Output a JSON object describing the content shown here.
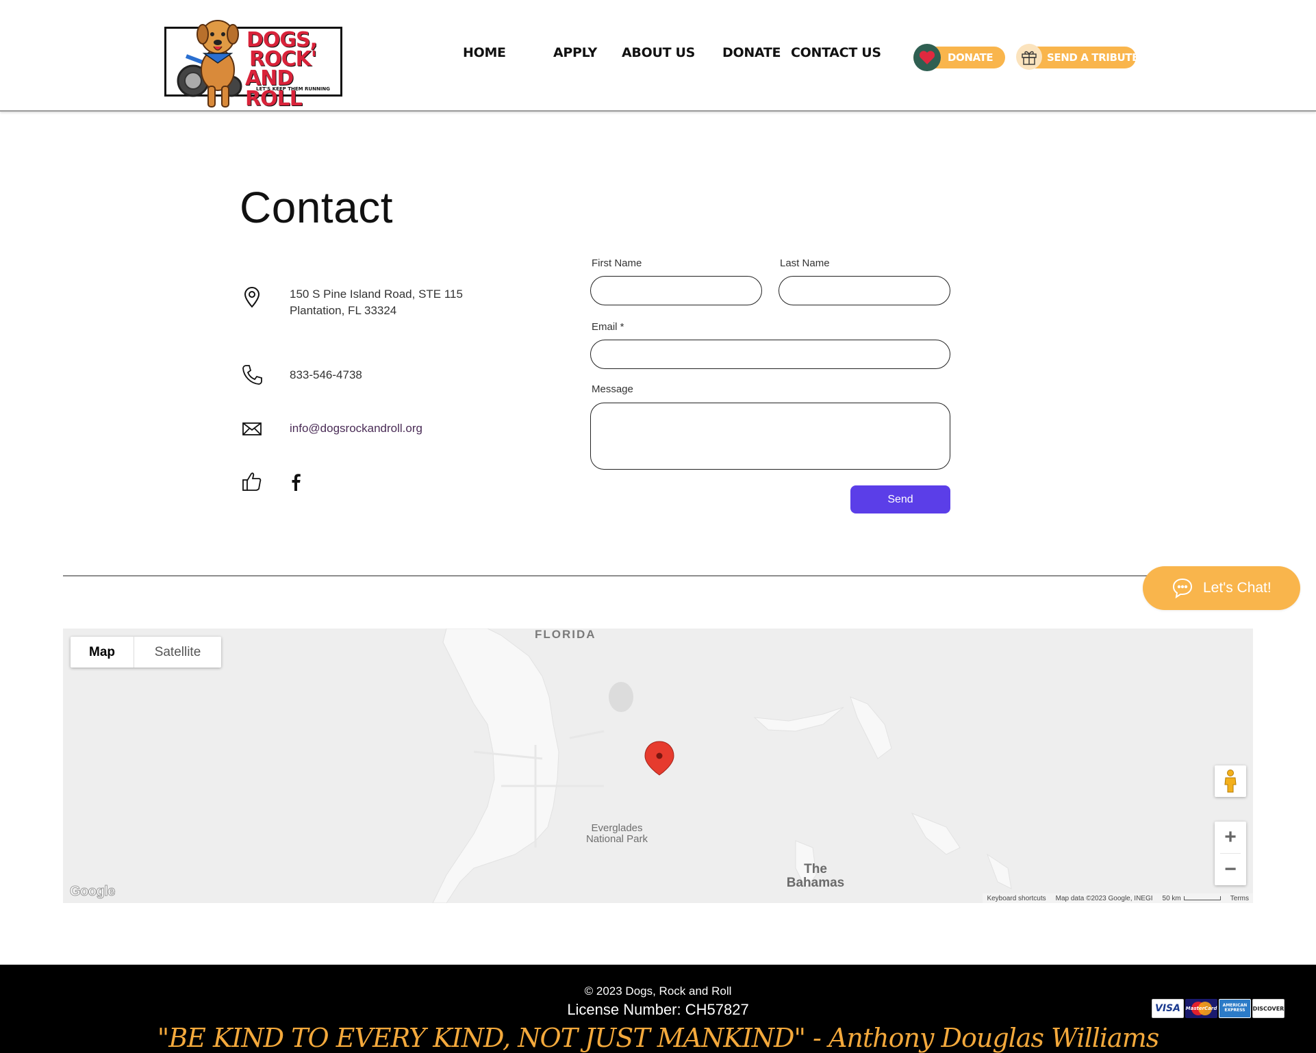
{
  "header": {
    "logo": {
      "line1": "DOGS,",
      "line2": "ROCK'",
      "line3": "AND ROLL",
      "tagline": "LET'S KEEP THEM RUNNING"
    },
    "nav": [
      "HOME",
      "APPLY",
      "ABOUT US",
      "DONATE",
      "CONTACT US"
    ],
    "donate_button": "DONATE",
    "tribute_button": "SEND A TRIBUTE"
  },
  "contact": {
    "title": "Contact",
    "address_line1": "150 S Pine Island Road, STE 115",
    "address_line2": "Plantation, FL 33324",
    "phone": "833-546-4738",
    "email": "info@dogsrockandroll.org"
  },
  "form": {
    "first_name_label": "First Name",
    "last_name_label": "Last Name",
    "email_label": "Email *",
    "message_label": "Message",
    "first_name_value": "",
    "last_name_value": "",
    "email_value": "",
    "message_value": "",
    "send_label": "Send"
  },
  "chat": {
    "label": "Let's Chat!"
  },
  "map": {
    "type_options": [
      "Map",
      "Satellite"
    ],
    "selected_type": "Map",
    "labels": {
      "state": "FLORIDA",
      "park_line1": "Everglades",
      "park_line2": "National Park",
      "islands_line1": "The",
      "islands_line2": "Bahamas"
    },
    "google_logo": "Google",
    "footer": {
      "shortcuts": "Keyboard shortcuts",
      "data": "Map data ©2023 Google, INEGI",
      "scale": "50 km",
      "terms": "Terms"
    },
    "zoom_in": "+",
    "zoom_out": "−"
  },
  "footer": {
    "copyright": "© 2023 Dogs, Rock and Roll",
    "license": "License Number: CH57827",
    "quote": "\"BE KIND TO EVERY KIND, NOT JUST MANKIND\" - Anthony Douglas Williams",
    "cards": [
      "VISA",
      "MasterCard",
      "AMERICAN EXPRESS",
      "DISCOVER"
    ]
  },
  "colors": {
    "accent_orange": "#f9b54c",
    "send_purple": "#5b3ee8",
    "heart_red": "#e0293f",
    "footer_bg": "#000000",
    "quote_orange": "#f4a93c"
  }
}
